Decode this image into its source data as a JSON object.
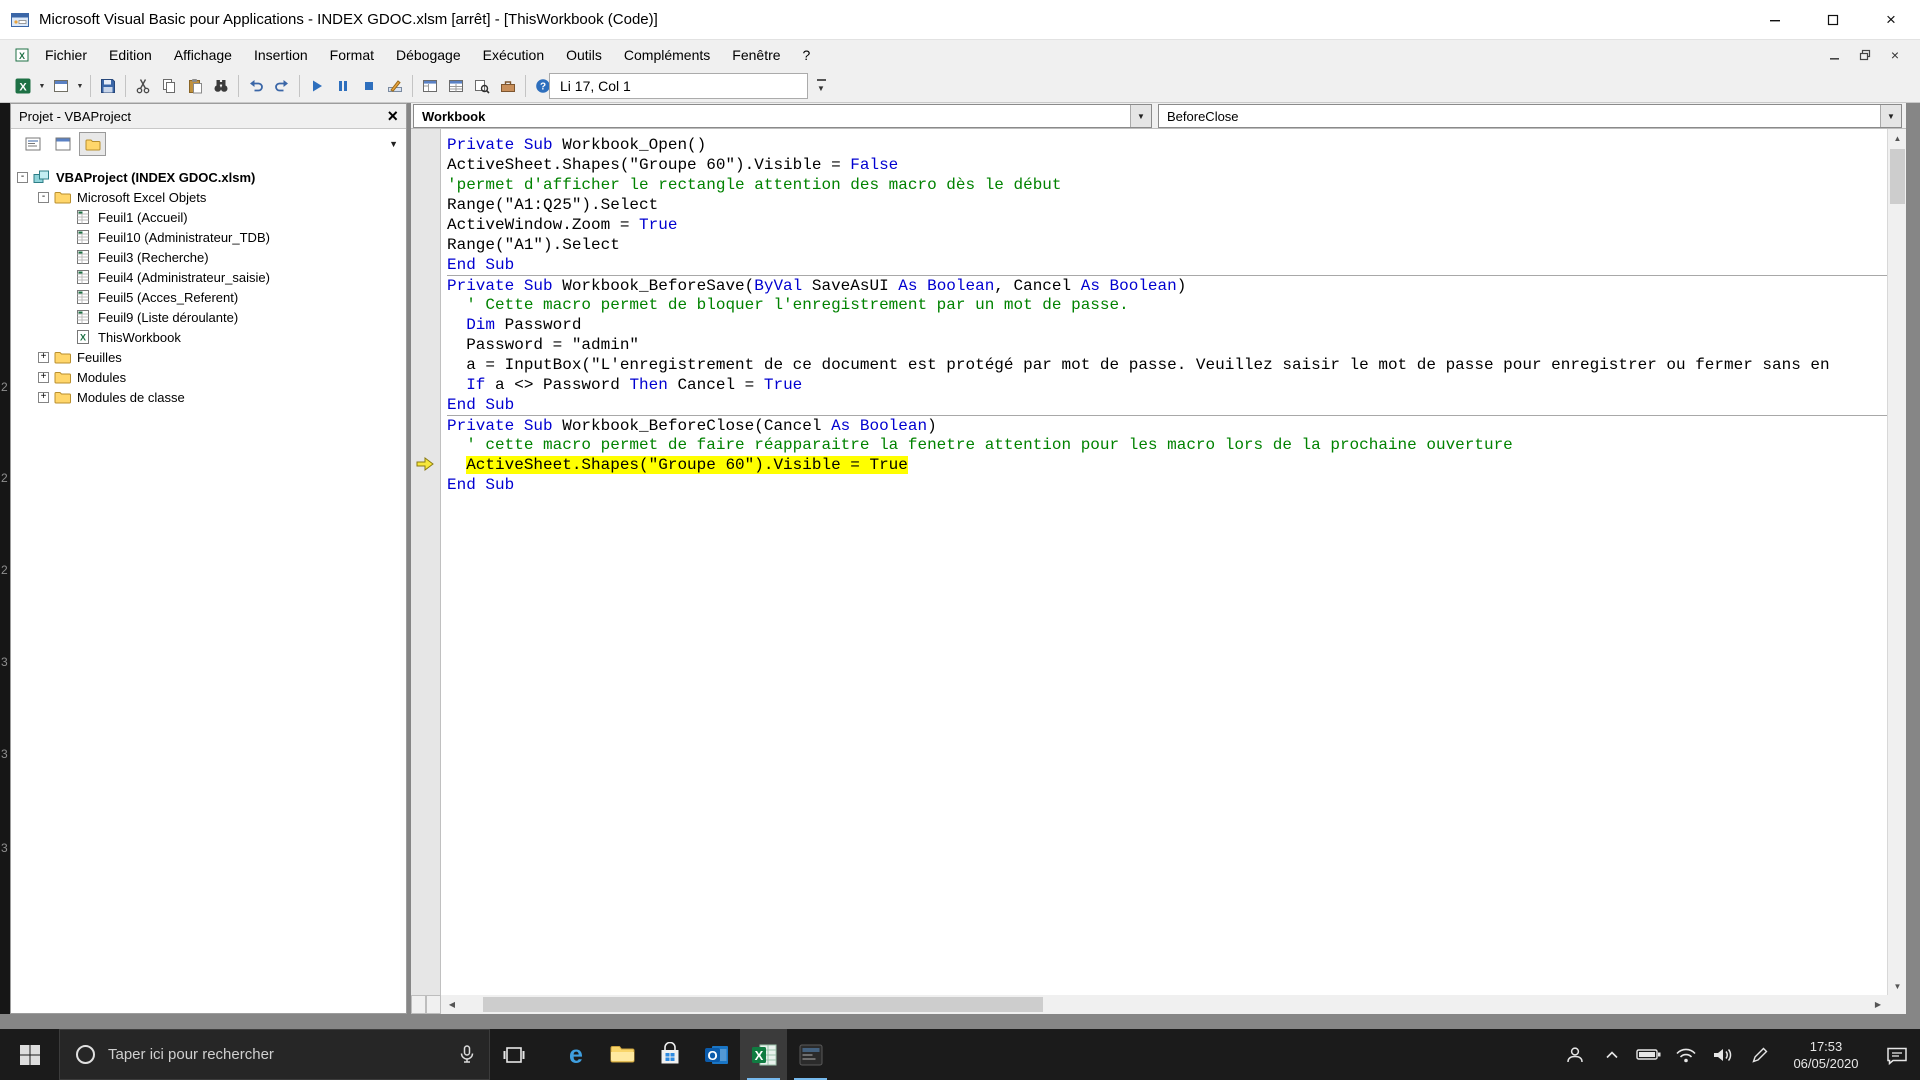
{
  "titlebar": {
    "title": "Microsoft Visual Basic pour Applications - INDEX GDOC.xlsm [arrêt] - [ThisWorkbook (Code)]"
  },
  "menubar": {
    "items": [
      "Fichier",
      "Edition",
      "Affichage",
      "Insertion",
      "Format",
      "Débogage",
      "Exécution",
      "Outils",
      "Compléments",
      "Fenêtre",
      "?"
    ]
  },
  "toolbar": {
    "position_indicator": "Li 17, Col 1",
    "dropdown_buttons": [
      "view-excel",
      "insert-userform"
    ],
    "groups": [
      [
        "view-excel",
        "insert-userform"
      ],
      [
        "save"
      ],
      [
        "cut",
        "copy",
        "paste",
        "find"
      ],
      [
        "undo",
        "redo"
      ],
      [
        "run",
        "break",
        "reset",
        "design-mode"
      ],
      [
        "project-explorer",
        "properties-window",
        "object-browser",
        "toolbox"
      ],
      [
        "help"
      ]
    ]
  },
  "project_panel": {
    "title": "Projet - VBAProject",
    "tree": [
      {
        "level": 0,
        "expander": "-",
        "icon": "project",
        "label": "VBAProject (INDEX GDOC.xlsm)",
        "bold": true
      },
      {
        "level": 1,
        "expander": "-",
        "icon": "folder",
        "label": "Microsoft Excel Objets"
      },
      {
        "level": 2,
        "expander": "",
        "icon": "sheet",
        "label": "Feuil1 (Accueil)"
      },
      {
        "level": 2,
        "expander": "",
        "icon": "sheet",
        "label": "Feuil10 (Administrateur_TDB)"
      },
      {
        "level": 2,
        "expander": "",
        "icon": "sheet",
        "label": "Feuil3 (Recherche)"
      },
      {
        "level": 2,
        "expander": "",
        "icon": "sheet",
        "label": "Feuil4 (Administrateur_saisie)"
      },
      {
        "level": 2,
        "expander": "",
        "icon": "sheet",
        "label": "Feuil5 (Acces_Referent)"
      },
      {
        "level": 2,
        "expander": "",
        "icon": "sheet",
        "label": "Feuil9 (Liste déroulante)"
      },
      {
        "level": 2,
        "expander": "",
        "icon": "workbook",
        "label": "ThisWorkbook"
      },
      {
        "level": 1,
        "expander": "+",
        "icon": "folder",
        "label": "Feuilles"
      },
      {
        "level": 1,
        "expander": "+",
        "icon": "folder",
        "label": "Modules"
      },
      {
        "level": 1,
        "expander": "+",
        "icon": "folder",
        "label": "Modules de classe"
      }
    ]
  },
  "code_window": {
    "object_combo": "Workbook",
    "procedure_combo": "BeforeClose",
    "lines": [
      {
        "seg": [
          [
            "kw",
            "Private Sub "
          ],
          [
            "tx",
            "Workbook_Open()"
          ]
        ]
      },
      {
        "seg": [
          [
            "tx",
            "ActiveSheet.Shapes(\"Groupe 60\").Visible = "
          ],
          [
            "kw",
            "False"
          ]
        ]
      },
      {
        "seg": [
          [
            "cm",
            "'permet d'afficher le rectangle attention des macro dès le début"
          ]
        ]
      },
      {
        "seg": [
          [
            "tx",
            "Range(\"A1:Q25\").Select"
          ]
        ]
      },
      {
        "seg": [
          [
            "tx",
            "ActiveWindow.Zoom = "
          ],
          [
            "kw",
            "True"
          ]
        ]
      },
      {
        "seg": [
          [
            "tx",
            "Range(\"A1\").Select"
          ]
        ]
      },
      {
        "seg": [
          [
            "kw",
            "End Sub"
          ]
        ]
      },
      {
        "sep": true,
        "seg": [
          [
            "kw",
            "Private Sub "
          ],
          [
            "tx",
            "Workbook_BeforeSave("
          ],
          [
            "kw",
            "ByVal"
          ],
          [
            "tx",
            " SaveAsUI "
          ],
          [
            "kw",
            "As Boolean"
          ],
          [
            "tx",
            ", Cancel "
          ],
          [
            "kw",
            "As Boolean"
          ],
          [
            "tx",
            ")"
          ]
        ]
      },
      {
        "seg": [
          [
            "cm",
            "  ' Cette macro permet de bloquer l'enregistrement par un mot de passe."
          ]
        ]
      },
      {
        "seg": [
          [
            "tx",
            "  "
          ],
          [
            "kw",
            "Dim"
          ],
          [
            "tx",
            " Password"
          ]
        ]
      },
      {
        "seg": [
          [
            "tx",
            "  Password = \"admin\""
          ]
        ]
      },
      {
        "seg": [
          [
            "tx",
            "  a = InputBox(\"L'enregistrement de ce document est protégé par mot de passe. Veuillez saisir le mot de passe pour enregistrer ou fermer sans en"
          ]
        ]
      },
      {
        "seg": [
          [
            "tx",
            "  "
          ],
          [
            "kw",
            "If"
          ],
          [
            "tx",
            " a <> Password "
          ],
          [
            "kw",
            "Then"
          ],
          [
            "tx",
            " Cancel = "
          ],
          [
            "kw",
            "True"
          ]
        ]
      },
      {
        "seg": [
          [
            "kw",
            "End Sub"
          ]
        ]
      },
      {
        "sep": true,
        "seg": [
          [
            "kw",
            "Private Sub "
          ],
          [
            "tx",
            "Workbook_BeforeClose(Cancel "
          ],
          [
            "kw",
            "As Boolean"
          ],
          [
            "tx",
            ")"
          ]
        ]
      },
      {
        "seg": [
          [
            "cm",
            "  ' cette macro permet de faire réapparaitre la fenetre attention pour les macro lors de la prochaine ouverture"
          ]
        ]
      },
      {
        "hl": true,
        "indent": "  ",
        "seg": [
          [
            "tx",
            "ActiveSheet.Shapes(\"Groupe 60\").Visible = True"
          ]
        ]
      },
      {
        "seg": [
          [
            "kw",
            "End Sub"
          ]
        ]
      }
    ]
  },
  "taskbar": {
    "search_placeholder": "Taper ici pour rechercher",
    "clock_time": "17:53",
    "clock_date": "06/05/2020",
    "apps": [
      {
        "name": "edge"
      },
      {
        "name": "explorer"
      },
      {
        "name": "store"
      },
      {
        "name": "outlook"
      },
      {
        "name": "excel",
        "active": true,
        "running": true
      },
      {
        "name": "vba-editor",
        "running": true
      }
    ],
    "tray": [
      "people",
      "chevron-up",
      "battery",
      "network",
      "volume",
      "pen"
    ]
  },
  "edge_numbers": [
    "2",
    "2",
    "2",
    "3",
    "3",
    "3"
  ]
}
